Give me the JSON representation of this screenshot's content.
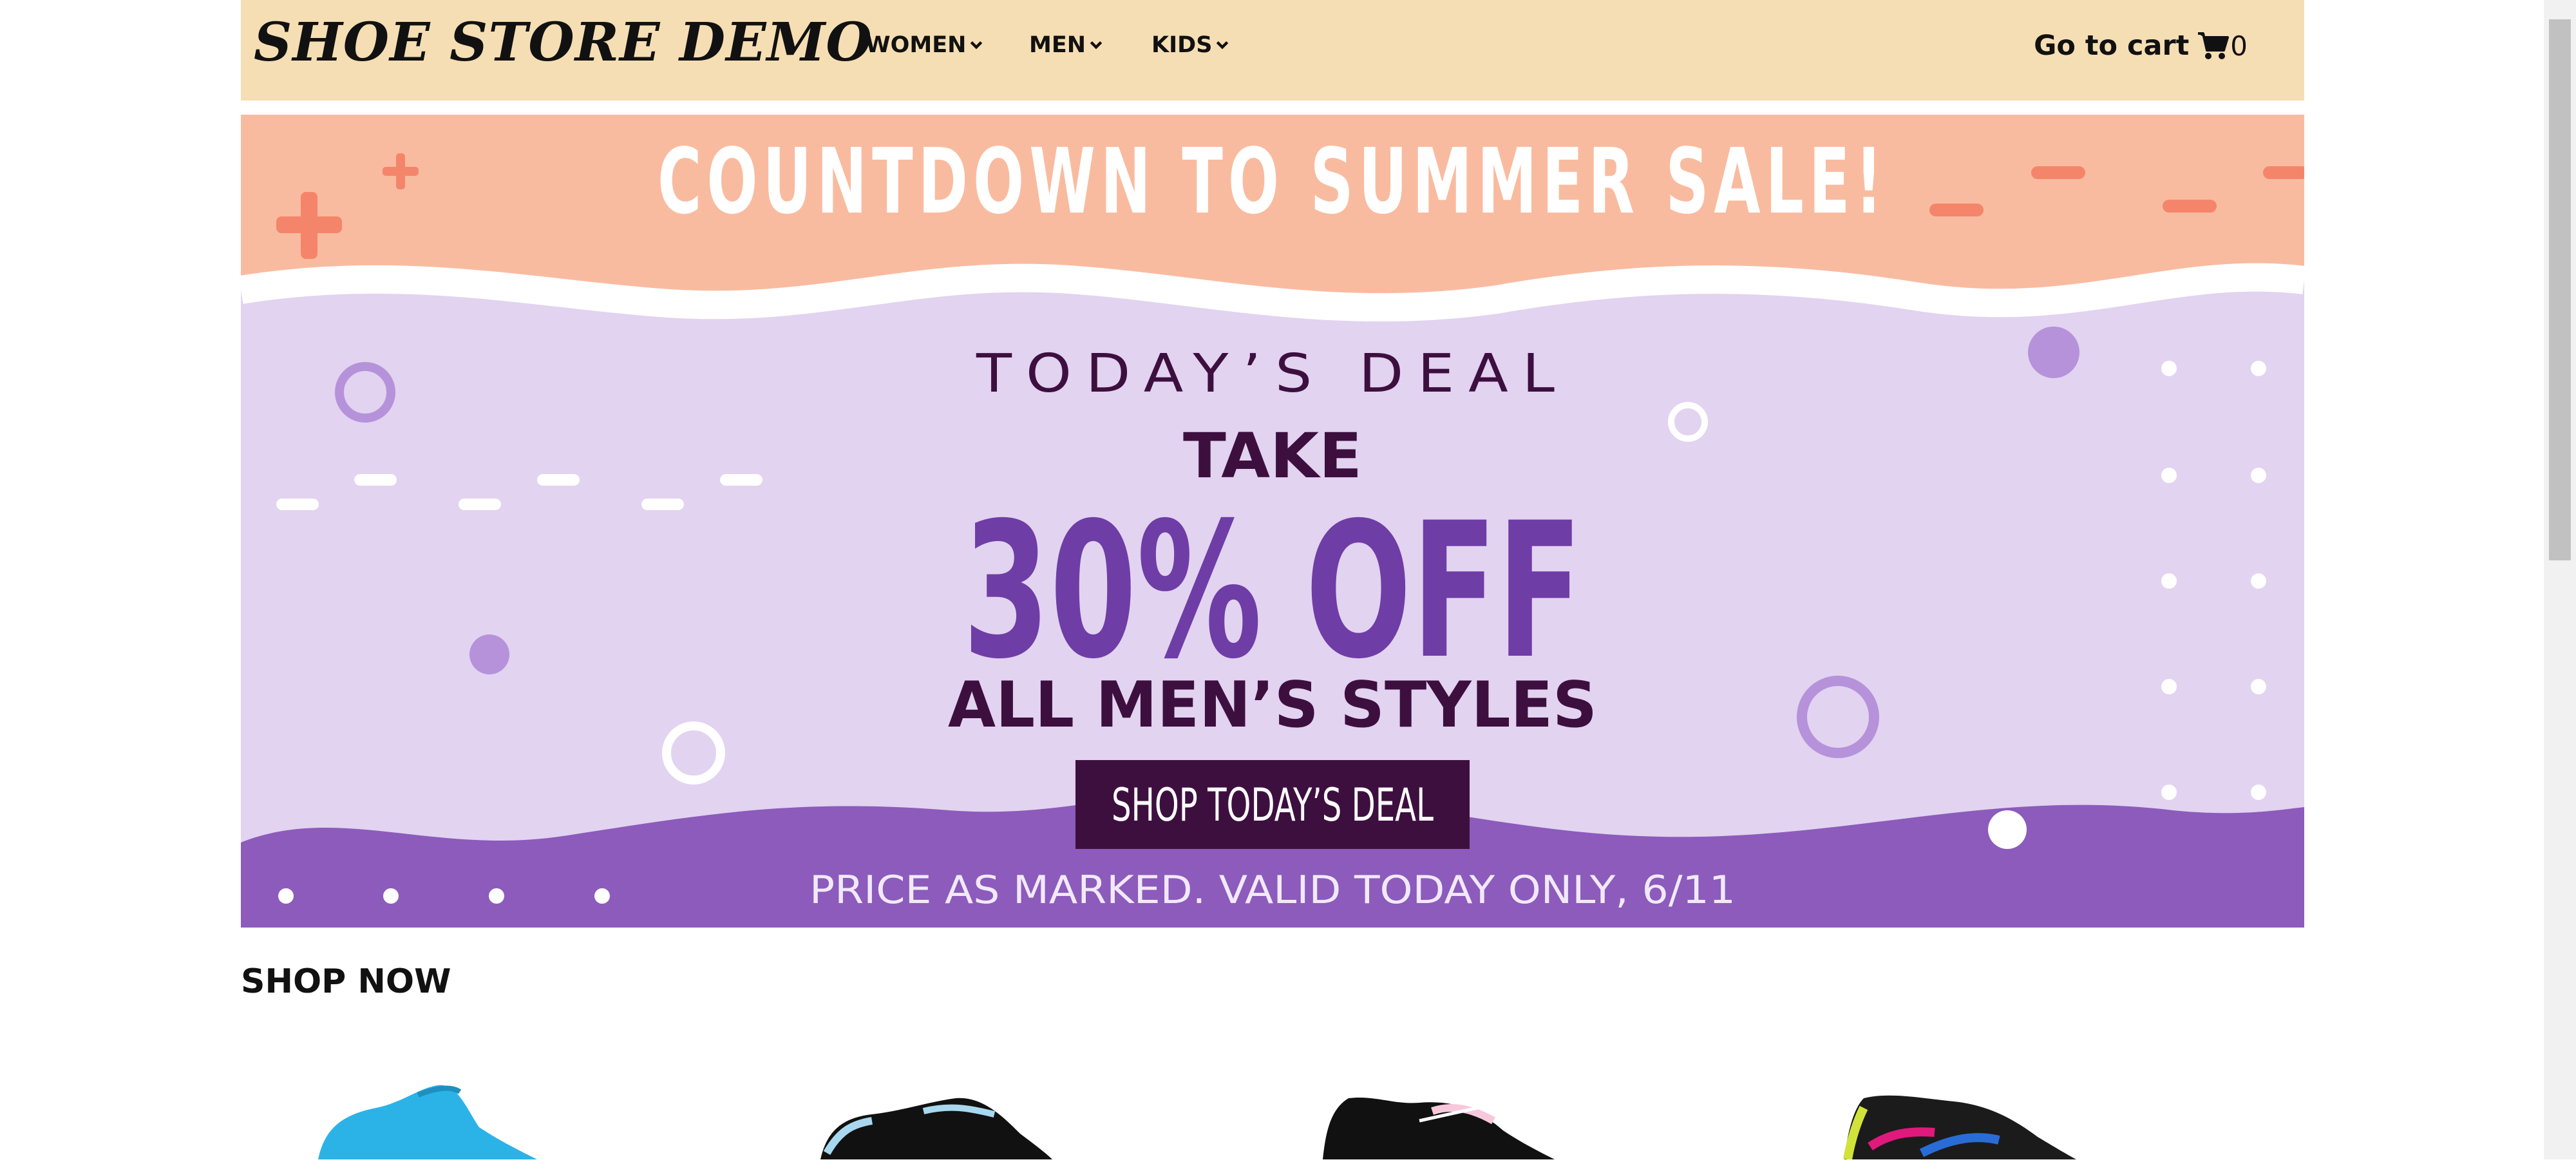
{
  "header": {
    "brand": "SHOE STORE DEMO",
    "nav": [
      {
        "label": "WOMEN"
      },
      {
        "label": "MEN"
      },
      {
        "label": "KIDS"
      }
    ],
    "cart_label": "Go to cart",
    "cart_count": "0",
    "cart_icon": "shopping-cart-icon",
    "chevron_icon": "chevron-down-icon"
  },
  "banner": {
    "headline": "COUNTDOWN TO SUMMER SALE!",
    "deal_label": "TODAY’S DEAL",
    "take": "TAKE",
    "discount": "30% OFF",
    "scope": "ALL MEN’S STYLES",
    "cta": "SHOP TODAY’S DEAL",
    "fine_print": "PRICE AS MARKED. VALID TODAY ONLY, 6/11",
    "colors": {
      "peach": "#f9bb9f",
      "lavender": "#e2d3f0",
      "purple": "#8c5bbc",
      "dark_plum": "#3d0f3f",
      "violet_text": "#6f3da6",
      "coral": "#f4856b"
    }
  },
  "section": {
    "title": "SHOP NOW"
  },
  "products": [
    {
      "name": "blue shoe",
      "color": "#2bb3e8"
    },
    {
      "name": "black light-blue shoe",
      "color": "#111111"
    },
    {
      "name": "black pink shoe",
      "color": "#111111"
    },
    {
      "name": "multicolor shoe",
      "color": "#1b1b1b"
    }
  ]
}
